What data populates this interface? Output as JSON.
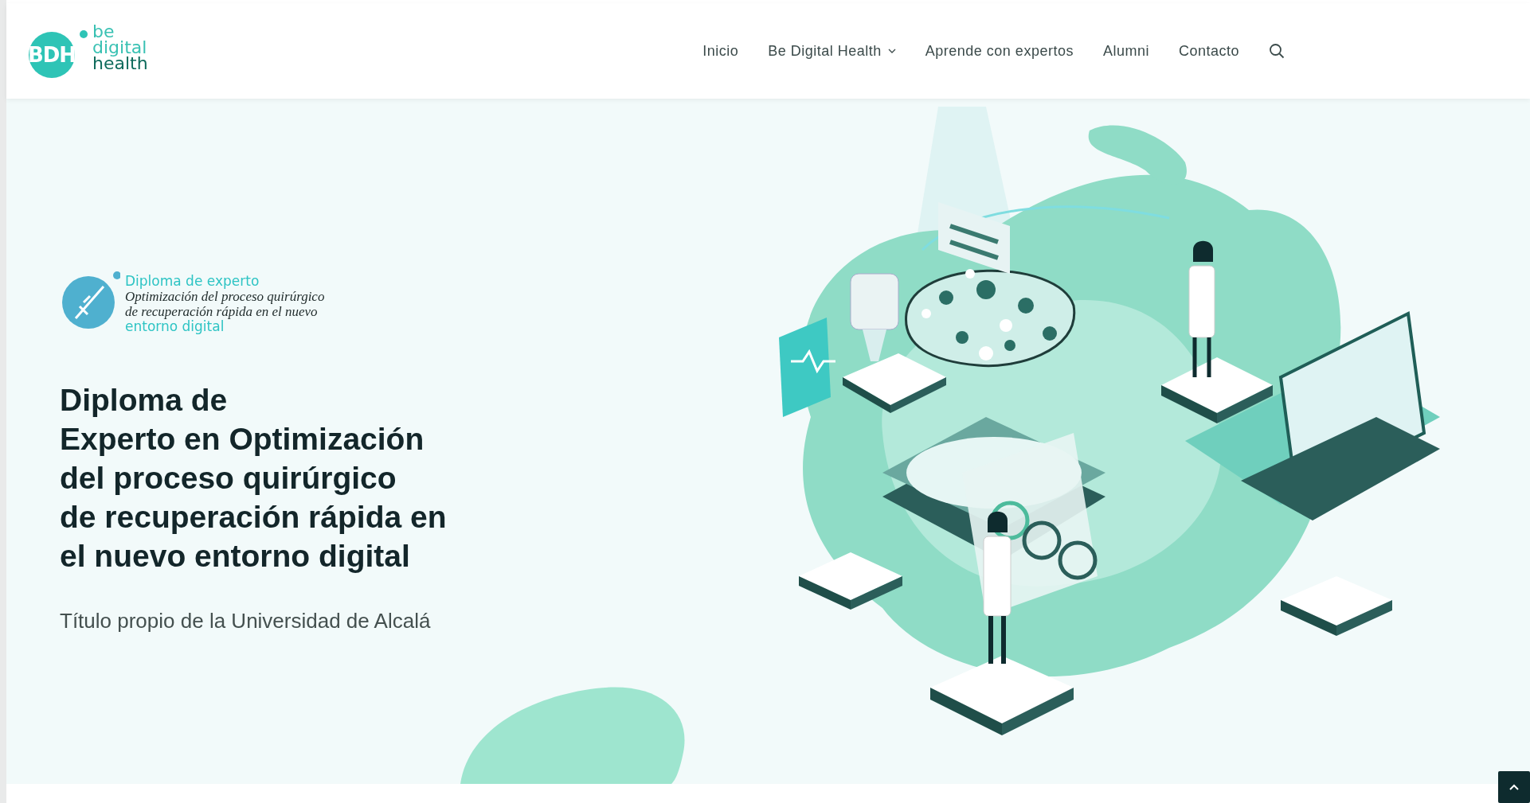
{
  "header": {
    "logo": {
      "initials": "BDH",
      "words": [
        "be",
        "digital",
        "health"
      ]
    },
    "nav": [
      {
        "label": "Inicio",
        "has_dropdown": false
      },
      {
        "label": "Be Digital Health",
        "has_dropdown": true
      },
      {
        "label": "Aprende con expertos",
        "has_dropdown": false
      },
      {
        "label": "Alumni",
        "has_dropdown": false
      },
      {
        "label": "Contacto",
        "has_dropdown": false
      }
    ]
  },
  "hero": {
    "badge": {
      "kicker": "Diploma de experto",
      "lines": [
        "Optimización del proceso quirúrgico",
        "de recuperación rápida en el nuevo"
      ],
      "tail": "entorno digital"
    },
    "title_lines": [
      "Diploma de",
      "Experto en Optimización",
      "del proceso quirúrgico",
      "de recuperación rápida en",
      "el nuevo entorno digital"
    ],
    "subtitle": "Título propio de la Universidad de Alcalá"
  }
}
